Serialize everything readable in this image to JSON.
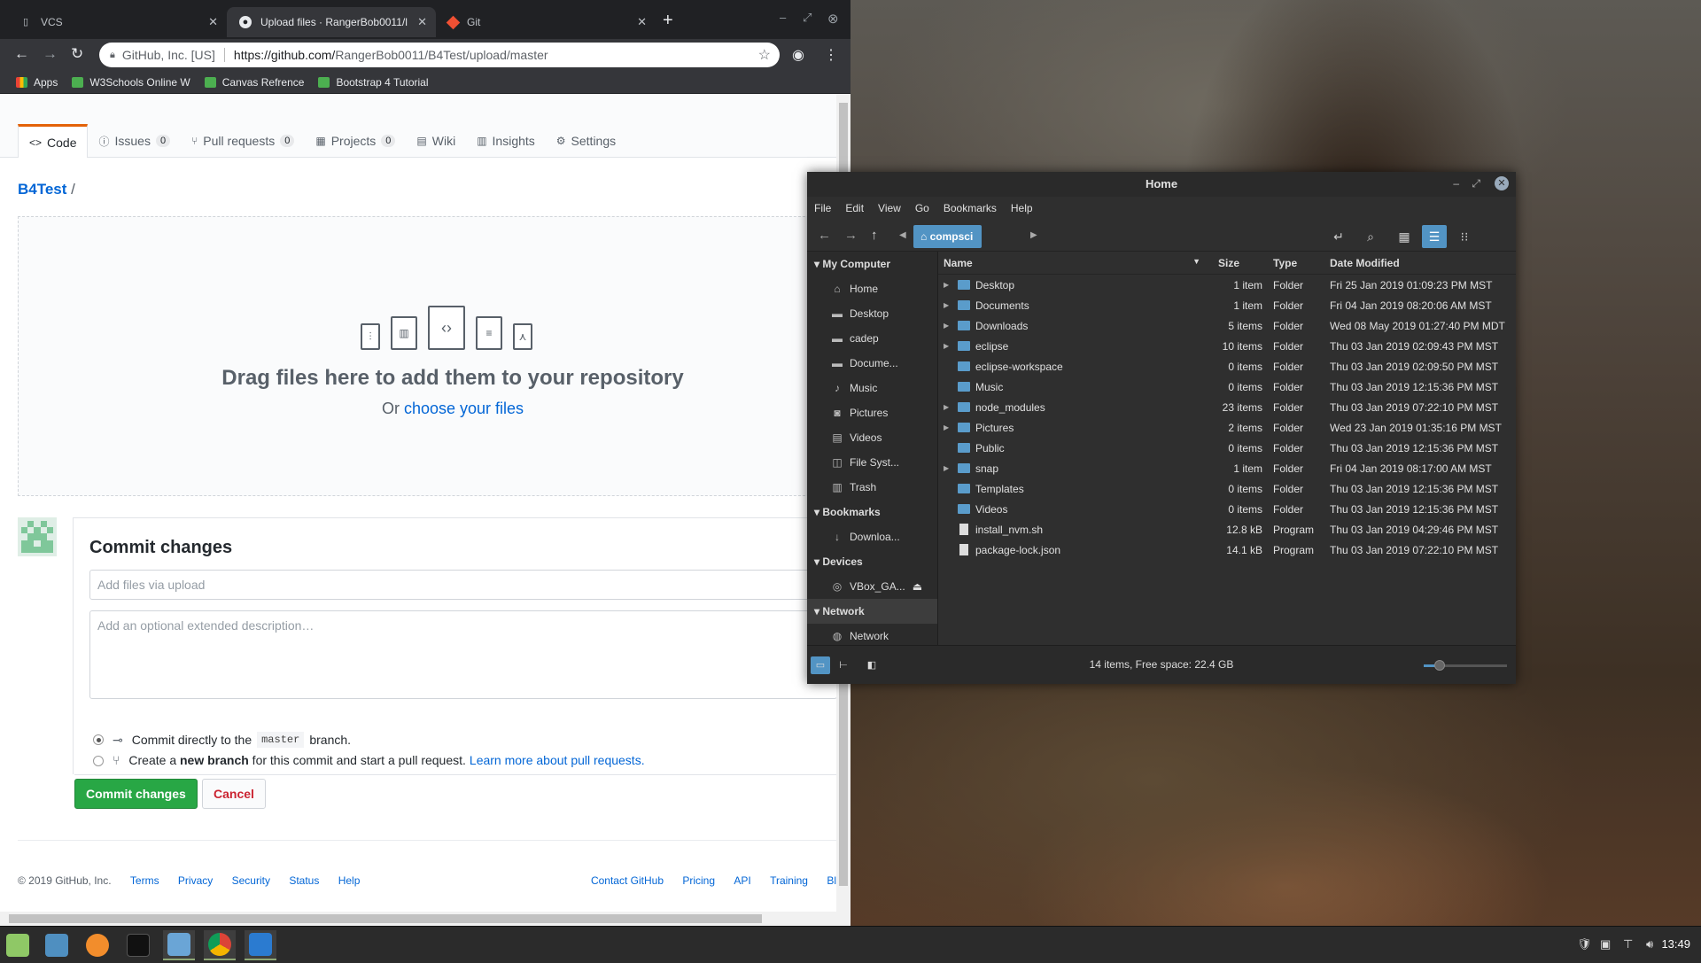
{
  "browser": {
    "tabs": [
      {
        "title": "VCS",
        "icon": "page-icon"
      },
      {
        "title": "Upload files · RangerBob0011/l",
        "icon": "github-icon"
      },
      {
        "title": "Git",
        "icon": "git-icon"
      }
    ],
    "org": "GitHub, Inc. [US]",
    "url_host": "https://github.com/",
    "url_path": "RangerBob0011/B4Test/upload/master",
    "bookmarks": [
      "Apps",
      "W3Schools Online W",
      "Canvas Refrence",
      "Bootstrap 4 Tutorial"
    ]
  },
  "github": {
    "nav": [
      {
        "label": "Code",
        "icon": "<>"
      },
      {
        "label": "Issues",
        "count": "0",
        "icon": "ⓘ"
      },
      {
        "label": "Pull requests",
        "count": "0",
        "icon": "⑂"
      },
      {
        "label": "Projects",
        "count": "0",
        "icon": "▦"
      },
      {
        "label": "Wiki",
        "icon": "▤"
      },
      {
        "label": "Insights",
        "icon": "▥"
      },
      {
        "label": "Settings",
        "icon": "⚙"
      }
    ],
    "breadcrumb_repo": "B4Test",
    "breadcrumb_sep": "/",
    "drop_title": "Drag files here to add them to your repository",
    "drop_or": "Or ",
    "drop_link": "choose your files",
    "commit_title": "Commit changes",
    "summary_placeholder": "Add files via upload",
    "desc_placeholder": "Add an optional extended description…",
    "opt1_pre": "Commit directly to the",
    "opt1_branch": "master",
    "opt1_post": "branch.",
    "opt2_pre": "Create a ",
    "opt2_bold": "new branch",
    "opt2_post": " for this commit and start a pull request.",
    "opt2_link": "Learn more about pull requests.",
    "btn_commit": "Commit changes",
    "btn_cancel": "Cancel",
    "footer_copy": "© 2019 GitHub, Inc.",
    "footer_left": [
      "Terms",
      "Privacy",
      "Security",
      "Status",
      "Help"
    ],
    "footer_right": [
      "Contact GitHub",
      "Pricing",
      "API",
      "Training",
      "Bl"
    ]
  },
  "nemo": {
    "title": "Home",
    "menu": [
      "File",
      "Edit",
      "View",
      "Go",
      "Bookmarks",
      "Help"
    ],
    "location": "compsci",
    "sidebar": [
      {
        "type": "header",
        "label": "My Computer"
      },
      {
        "type": "item",
        "label": "Home",
        "icon": "home-icon"
      },
      {
        "type": "item",
        "label": "Desktop",
        "icon": "folder-icon"
      },
      {
        "type": "item",
        "label": "cadep",
        "icon": "folder-icon"
      },
      {
        "type": "item",
        "label": "Docume...",
        "icon": "folder-icon"
      },
      {
        "type": "item",
        "label": "Music",
        "icon": "music-icon"
      },
      {
        "type": "item",
        "label": "Pictures",
        "icon": "camera-icon"
      },
      {
        "type": "item",
        "label": "Videos",
        "icon": "film-icon"
      },
      {
        "type": "item",
        "label": "File Syst...",
        "icon": "drive-icon"
      },
      {
        "type": "item",
        "label": "Trash",
        "icon": "trash-icon"
      },
      {
        "type": "header",
        "label": "Bookmarks"
      },
      {
        "type": "item",
        "label": "Downloa...",
        "icon": "download-icon"
      },
      {
        "type": "header",
        "label": "Devices"
      },
      {
        "type": "item",
        "label": "VBox_GA...",
        "icon": "disc-icon"
      },
      {
        "type": "header",
        "label": "Network"
      },
      {
        "type": "item",
        "label": "Network",
        "icon": "globe-icon"
      }
    ],
    "columns": [
      "Name",
      "Size",
      "Type",
      "Date Modified"
    ],
    "files": [
      {
        "name": "Desktop",
        "size": "1 item",
        "type": "Folder",
        "date": "Fri 25 Jan 2019 01:09:23 PM MST",
        "exp": true,
        "kind": "folder"
      },
      {
        "name": "Documents",
        "size": "1 item",
        "type": "Folder",
        "date": "Fri 04 Jan 2019 08:20:06 AM MST",
        "exp": true,
        "kind": "folder"
      },
      {
        "name": "Downloads",
        "size": "5 items",
        "type": "Folder",
        "date": "Wed 08 May 2019 01:27:40 PM MDT",
        "exp": true,
        "kind": "folder"
      },
      {
        "name": "eclipse",
        "size": "10 items",
        "type": "Folder",
        "date": "Thu 03 Jan 2019 02:09:43 PM MST",
        "exp": true,
        "kind": "folder"
      },
      {
        "name": "eclipse-workspace",
        "size": "0 items",
        "type": "Folder",
        "date": "Thu 03 Jan 2019 02:09:50 PM MST",
        "exp": false,
        "kind": "folder"
      },
      {
        "name": "Music",
        "size": "0 items",
        "type": "Folder",
        "date": "Thu 03 Jan 2019 12:15:36 PM MST",
        "exp": false,
        "kind": "folder"
      },
      {
        "name": "node_modules",
        "size": "23 items",
        "type": "Folder",
        "date": "Thu 03 Jan 2019 07:22:10 PM MST",
        "exp": true,
        "kind": "folder"
      },
      {
        "name": "Pictures",
        "size": "2 items",
        "type": "Folder",
        "date": "Wed 23 Jan 2019 01:35:16 PM MST",
        "exp": true,
        "kind": "folder"
      },
      {
        "name": "Public",
        "size": "0 items",
        "type": "Folder",
        "date": "Thu 03 Jan 2019 12:15:36 PM MST",
        "exp": false,
        "kind": "folder"
      },
      {
        "name": "snap",
        "size": "1 item",
        "type": "Folder",
        "date": "Fri 04 Jan 2019 08:17:00 AM MST",
        "exp": true,
        "kind": "folder"
      },
      {
        "name": "Templates",
        "size": "0 items",
        "type": "Folder",
        "date": "Thu 03 Jan 2019 12:15:36 PM MST",
        "exp": false,
        "kind": "folder"
      },
      {
        "name": "Videos",
        "size": "0 items",
        "type": "Folder",
        "date": "Thu 03 Jan 2019 12:15:36 PM MST",
        "exp": false,
        "kind": "folder"
      },
      {
        "name": "install_nvm.sh",
        "size": "12.8 kB",
        "type": "Program",
        "date": "Thu 03 Jan 2019 04:29:46 PM MST",
        "exp": false,
        "kind": "file"
      },
      {
        "name": "package-lock.json",
        "size": "14.1 kB",
        "type": "Program",
        "date": "Thu 03 Jan 2019 07:22:10 PM MST",
        "exp": false,
        "kind": "file"
      }
    ],
    "status": "14 items, Free space: 22.4 GB"
  },
  "taskbar": {
    "clock": "13:49"
  }
}
